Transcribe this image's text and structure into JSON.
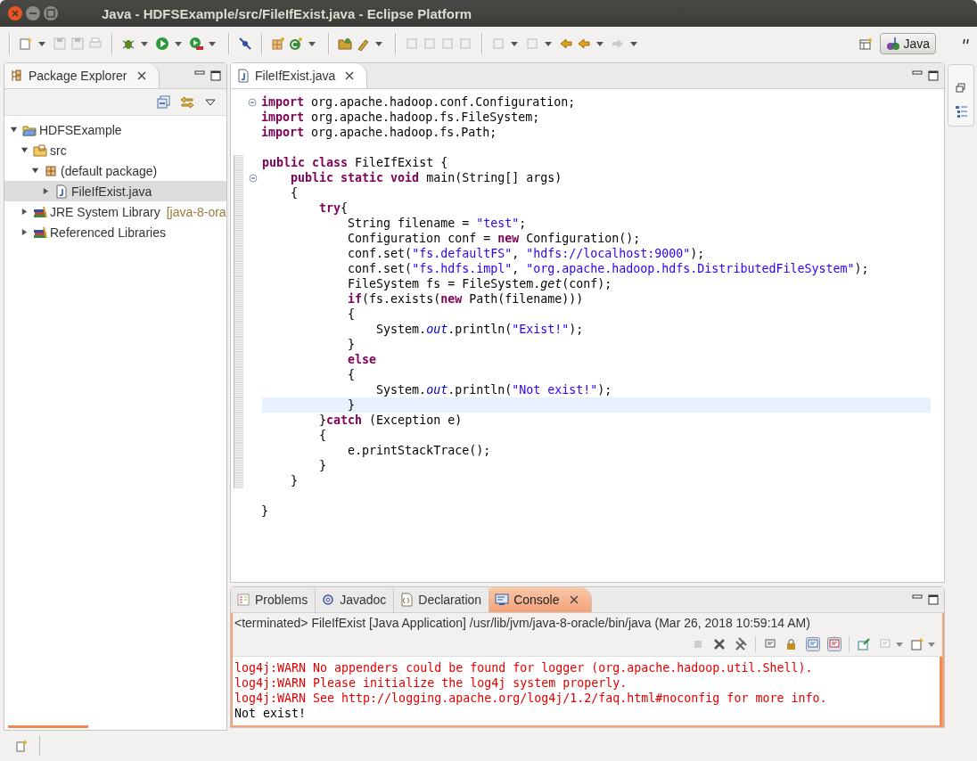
{
  "window": {
    "title": "Java - HDFSExample/src/FileIfExist.java - Eclipse Platform"
  },
  "perspective": {
    "label": "Java",
    "selected": true
  },
  "package_explorer": {
    "title": "Package Explorer",
    "tree": [
      {
        "kind": "project",
        "label": "HDFSExample",
        "expanded": true,
        "selected": false,
        "children": [
          {
            "kind": "source-folder",
            "label": "src",
            "expanded": true,
            "selected": false,
            "children": [
              {
                "kind": "package",
                "label": "(default package)",
                "expanded": true,
                "selected": false,
                "children": [
                  {
                    "kind": "java-file",
                    "label": "FileIfExist.java",
                    "expanded": false,
                    "selected": true
                  }
                ]
              }
            ]
          },
          {
            "kind": "library",
            "label": "JRE System Library",
            "decoration": "[java-8-ora",
            "expanded": false,
            "selected": false
          },
          {
            "kind": "library",
            "label": "Referenced Libraries",
            "expanded": false,
            "selected": false
          }
        ]
      }
    ]
  },
  "editor": {
    "tab": "FileIfExist.java",
    "lines": [
      {
        "fold": true,
        "changed": false,
        "current": false,
        "tokens": [
          {
            "kind": "keyword",
            "text": "import"
          },
          {
            "kind": "plain",
            "text": " org.apache.hadoop.conf.Configuration;"
          }
        ]
      },
      {
        "fold": false,
        "changed": false,
        "current": false,
        "tokens": [
          {
            "kind": "keyword",
            "text": "import"
          },
          {
            "kind": "plain",
            "text": " org.apache.hadoop.fs.FileSystem;"
          }
        ]
      },
      {
        "fold": false,
        "changed": false,
        "current": false,
        "tokens": [
          {
            "kind": "keyword",
            "text": "import"
          },
          {
            "kind": "plain",
            "text": " org.apache.hadoop.fs.Path;"
          }
        ]
      },
      {
        "fold": false,
        "changed": false,
        "current": false
      },
      {
        "fold": false,
        "changed": true,
        "current": false,
        "tokens": [
          {
            "kind": "keyword",
            "text": "public class"
          },
          {
            "kind": "plain",
            "text": " FileIfExist {"
          }
        ]
      },
      {
        "fold": true,
        "changed": true,
        "current": false,
        "tokens": [
          {
            "kind": "keyword",
            "text": "    public static void"
          },
          {
            "kind": "plain",
            "text": " main(String[] args)"
          }
        ]
      },
      {
        "fold": false,
        "changed": true,
        "current": false,
        "tokens": [
          {
            "kind": "plain",
            "text": "    {"
          }
        ]
      },
      {
        "fold": false,
        "changed": true,
        "current": false,
        "tokens": [
          {
            "kind": "keyword",
            "text": "        try"
          },
          {
            "kind": "plain",
            "text": "{"
          }
        ]
      },
      {
        "fold": false,
        "changed": true,
        "current": false,
        "tokens": [
          {
            "kind": "plain",
            "text": "            String filename = "
          },
          {
            "kind": "string",
            "text": "\"test\""
          },
          {
            "kind": "plain",
            "text": ";"
          }
        ]
      },
      {
        "fold": false,
        "changed": true,
        "current": false,
        "tokens": [
          {
            "kind": "plain",
            "text": "            Configuration conf = "
          },
          {
            "kind": "keyword",
            "text": "new"
          },
          {
            "kind": "plain",
            "text": " Configuration();"
          }
        ]
      },
      {
        "fold": false,
        "changed": true,
        "current": false,
        "tokens": [
          {
            "kind": "plain",
            "text": "            conf.set("
          },
          {
            "kind": "string",
            "text": "\"fs.defaultFS\""
          },
          {
            "kind": "plain",
            "text": ", "
          },
          {
            "kind": "string",
            "text": "\"hdfs://localhost:9000\""
          },
          {
            "kind": "plain",
            "text": ");"
          }
        ]
      },
      {
        "fold": false,
        "changed": true,
        "current": false,
        "tokens": [
          {
            "kind": "plain",
            "text": "            conf.set("
          },
          {
            "kind": "string",
            "text": "\"fs.hdfs.impl\""
          },
          {
            "kind": "plain",
            "text": ", "
          },
          {
            "kind": "string",
            "text": "\"org.apache.hadoop.hdfs.DistributedFileSystem\""
          },
          {
            "kind": "plain",
            "text": ");"
          }
        ]
      },
      {
        "fold": false,
        "changed": true,
        "current": false,
        "tokens": [
          {
            "kind": "plain",
            "text": "            FileSystem fs = FileSystem."
          },
          {
            "kind": "static-method",
            "text": "get"
          },
          {
            "kind": "plain",
            "text": "(conf);"
          }
        ]
      },
      {
        "fold": false,
        "changed": true,
        "current": false,
        "tokens": [
          {
            "kind": "keyword",
            "text": "            if"
          },
          {
            "kind": "plain",
            "text": "(fs.exists("
          },
          {
            "kind": "keyword",
            "text": "new"
          },
          {
            "kind": "plain",
            "text": " Path(filename)))"
          }
        ]
      },
      {
        "fold": false,
        "changed": true,
        "current": false,
        "tokens": [
          {
            "kind": "plain",
            "text": "            {"
          }
        ]
      },
      {
        "fold": false,
        "changed": true,
        "current": false,
        "tokens": [
          {
            "kind": "plain",
            "text": "                System."
          },
          {
            "kind": "static-field",
            "text": "out"
          },
          {
            "kind": "plain",
            "text": ".println("
          },
          {
            "kind": "string",
            "text": "\"Exist!\""
          },
          {
            "kind": "plain",
            "text": ");"
          }
        ]
      },
      {
        "fold": false,
        "changed": true,
        "current": false,
        "tokens": [
          {
            "kind": "plain",
            "text": "            }"
          }
        ]
      },
      {
        "fold": false,
        "changed": true,
        "current": false,
        "tokens": [
          {
            "kind": "keyword",
            "text": "            else"
          }
        ]
      },
      {
        "fold": false,
        "changed": true,
        "current": false,
        "tokens": [
          {
            "kind": "plain",
            "text": "            {"
          }
        ]
      },
      {
        "fold": false,
        "changed": true,
        "current": false,
        "tokens": [
          {
            "kind": "plain",
            "text": "                System."
          },
          {
            "kind": "static-field",
            "text": "out"
          },
          {
            "kind": "plain",
            "text": ".println("
          },
          {
            "kind": "string",
            "text": "\"Not exist!\""
          },
          {
            "kind": "plain",
            "text": ");"
          }
        ]
      },
      {
        "fold": false,
        "changed": true,
        "current": true,
        "tokens": [
          {
            "kind": "plain",
            "text": "            }"
          }
        ]
      },
      {
        "fold": false,
        "changed": true,
        "current": false,
        "tokens": [
          {
            "kind": "plain",
            "text": "        }"
          },
          {
            "kind": "keyword",
            "text": "catch"
          },
          {
            "kind": "plain",
            "text": " (Exception e)"
          }
        ]
      },
      {
        "fold": false,
        "changed": true,
        "current": false,
        "tokens": [
          {
            "kind": "plain",
            "text": "        {"
          }
        ]
      },
      {
        "fold": false,
        "changed": true,
        "current": false,
        "tokens": [
          {
            "kind": "plain",
            "text": "            e.printStackTrace();"
          }
        ]
      },
      {
        "fold": false,
        "changed": true,
        "current": false,
        "tokens": [
          {
            "kind": "plain",
            "text": "        }"
          }
        ]
      },
      {
        "fold": false,
        "changed": true,
        "current": false,
        "tokens": [
          {
            "kind": "plain",
            "text": "    }"
          }
        ]
      },
      {
        "fold": false,
        "changed": false,
        "current": false
      },
      {
        "fold": false,
        "changed": false,
        "current": false,
        "tokens": [
          {
            "kind": "plain",
            "text": "}"
          }
        ]
      }
    ]
  },
  "bottom_panel": {
    "tabs": [
      {
        "kind": "problems",
        "label": "Problems",
        "selected": false
      },
      {
        "kind": "javadoc",
        "label": "Javadoc",
        "selected": false
      },
      {
        "kind": "declaration",
        "label": "Declaration",
        "selected": false
      },
      {
        "kind": "console",
        "label": "Console",
        "selected": true
      }
    ],
    "description": "<terminated> FileIfExist [Java Application] /usr/lib/jvm/java-8-oracle/bin/java (Mar 26, 2018 10:59:14 AM)",
    "output": [
      {
        "kind": "error",
        "text": "log4j:WARN No appenders could be found for logger (org.apache.hadoop.util.Shell)."
      },
      {
        "kind": "error",
        "text": "log4j:WARN Please initialize the log4j system properly."
      },
      {
        "kind": "error",
        "text": "log4j:WARN See http://logging.apache.org/log4j/1.2/faq.html#noconfig for more info."
      },
      {
        "kind": "output",
        "text": "Not exist!"
      }
    ]
  }
}
